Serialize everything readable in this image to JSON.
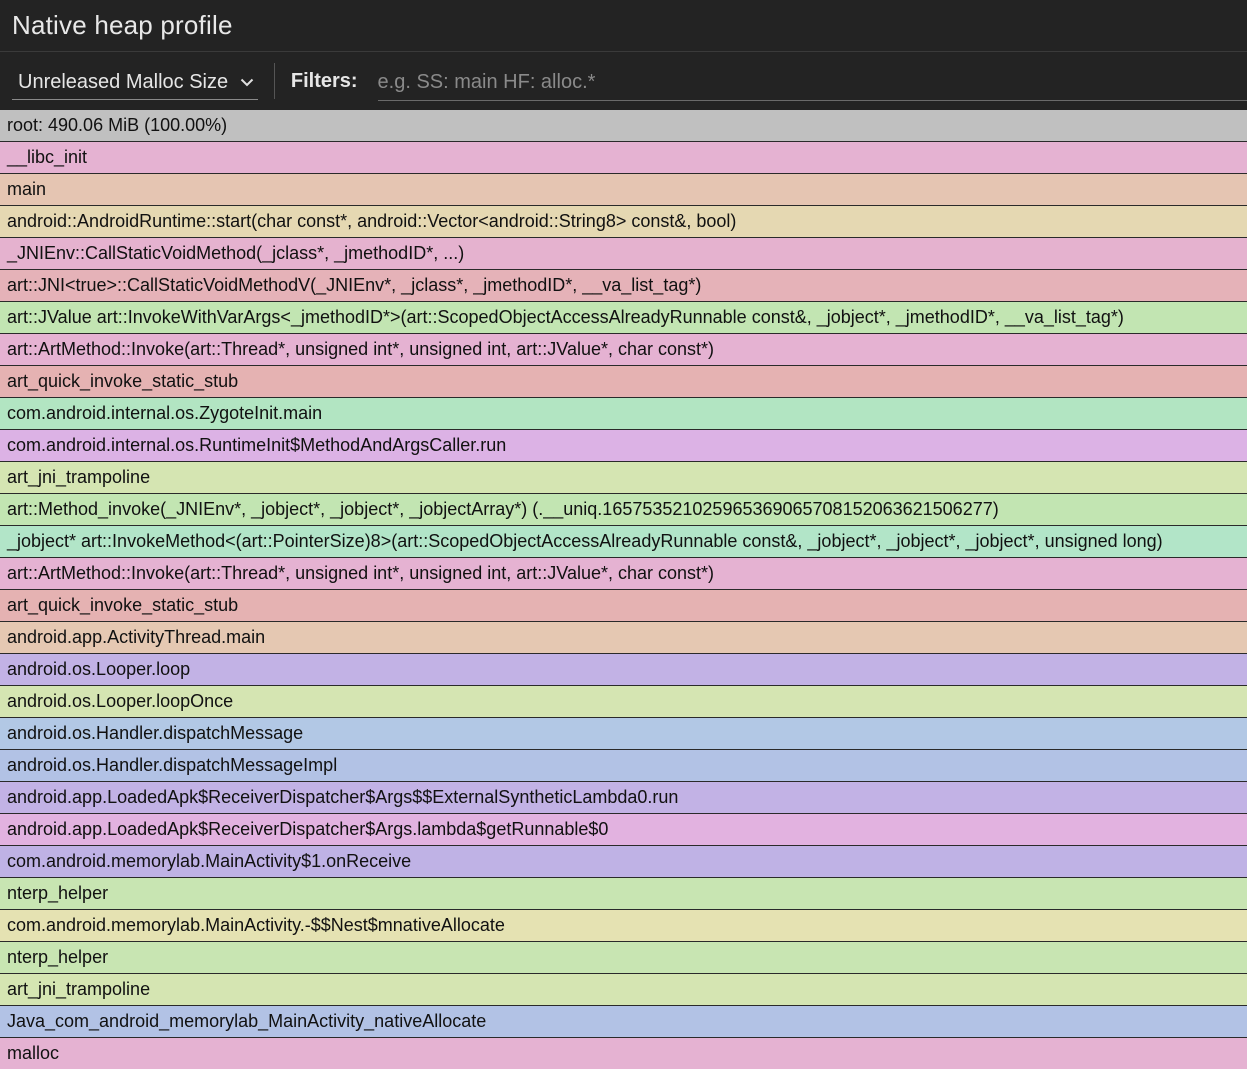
{
  "header": {
    "title": "Native heap profile"
  },
  "toolbar": {
    "select_value": "Unreleased Malloc Size",
    "filters_label": "Filters:",
    "filter_placeholder": "e.g. SS: main HF: alloc.*"
  },
  "icons": {
    "dropdown": "chevron-down-icon"
  },
  "frames": [
    {
      "label": "root: 490.06 MiB (100.00%)",
      "color": "#c0c0c0"
    },
    {
      "label": "__libc_init",
      "color": "#e5b2d2"
    },
    {
      "label": "main",
      "color": "#e5c5b2"
    },
    {
      "label": "android::AndroidRuntime::start(char const*, android::Vector<android::String8> const&, bool)",
      "color": "#e5d8b2"
    },
    {
      "label": "_JNIEnv::CallStaticVoidMethod(_jclass*, _jmethodID*, ...)",
      "color": "#e5b2cf"
    },
    {
      "label": "art::JNI<true>::CallStaticVoidMethodV(_JNIEnv*, _jclass*, _jmethodID*, __va_list_tag*)",
      "color": "#e5b2b8"
    },
    {
      "label": "art::JValue art::InvokeWithVarArgs<_jmethodID*>(art::ScopedObjectAccessAlreadyRunnable const&, _jobject*, _jmethodID*, __va_list_tag*)",
      "color": "#c2e5b2"
    },
    {
      "label": "art::ArtMethod::Invoke(art::Thread*, unsigned int*, unsigned int, art::JValue*, char const*)",
      "color": "#e5b2d2"
    },
    {
      "label": "art_quick_invoke_static_stub",
      "color": "#e5b2b2"
    },
    {
      "label": "com.android.internal.os.ZygoteInit.main",
      "color": "#b2e5c2"
    },
    {
      "label": "com.android.internal.os.RuntimeInit$MethodAndArgsCaller.run",
      "color": "#dcb2e5"
    },
    {
      "label": "art_jni_trampoline",
      "color": "#d5e5b2"
    },
    {
      "label": "art::Method_invoke(_JNIEnv*, _jobject*, _jobject*, _jobjectArray*) (.__uniq.165753521025965369065708152063621506277)",
      "color": "#c2e5b2"
    },
    {
      "label": "_jobject* art::InvokeMethod<(art::PointerSize)8>(art::ScopedObjectAccessAlreadyRunnable const&, _jobject*, _jobject*, _jobject*, unsigned long)",
      "color": "#b2e5c8"
    },
    {
      "label": "art::ArtMethod::Invoke(art::Thread*, unsigned int*, unsigned int, art::JValue*, char const*)",
      "color": "#e5b2d2"
    },
    {
      "label": "art_quick_invoke_static_stub",
      "color": "#e5b2b2"
    },
    {
      "label": "android.app.ActivityThread.main",
      "color": "#e5c8b2"
    },
    {
      "label": "android.os.Looper.loop",
      "color": "#c2b2e5"
    },
    {
      "label": "android.os.Looper.loopOnce",
      "color": "#d5e5b2"
    },
    {
      "label": "android.os.Handler.dispatchMessage",
      "color": "#b2c8e5"
    },
    {
      "label": "android.os.Handler.dispatchMessageImpl",
      "color": "#b2c2e5"
    },
    {
      "label": "android.app.LoadedApk$ReceiverDispatcher$Args$$ExternalSyntheticLambda0.run",
      "color": "#c2b2e5"
    },
    {
      "label": "android.app.LoadedApk$ReceiverDispatcher$Args.lambda$getRunnable$0",
      "color": "#e2b2e0"
    },
    {
      "label": "com.android.memorylab.MainActivity$1.onReceive",
      "color": "#bfb2e5"
    },
    {
      "label": "nterp_helper",
      "color": "#c8e5b2"
    },
    {
      "label": "com.android.memorylab.MainActivity.-$$Nest$mnativeAllocate",
      "color": "#e5e2b2"
    },
    {
      "label": "nterp_helper",
      "color": "#c8e5b2"
    },
    {
      "label": "art_jni_trampoline",
      "color": "#d5e5b2"
    },
    {
      "label": "Java_com_android_memorylab_MainActivity_nativeAllocate",
      "color": "#b2c2e5"
    },
    {
      "label": "malloc",
      "color": "#e5b2d2"
    }
  ]
}
